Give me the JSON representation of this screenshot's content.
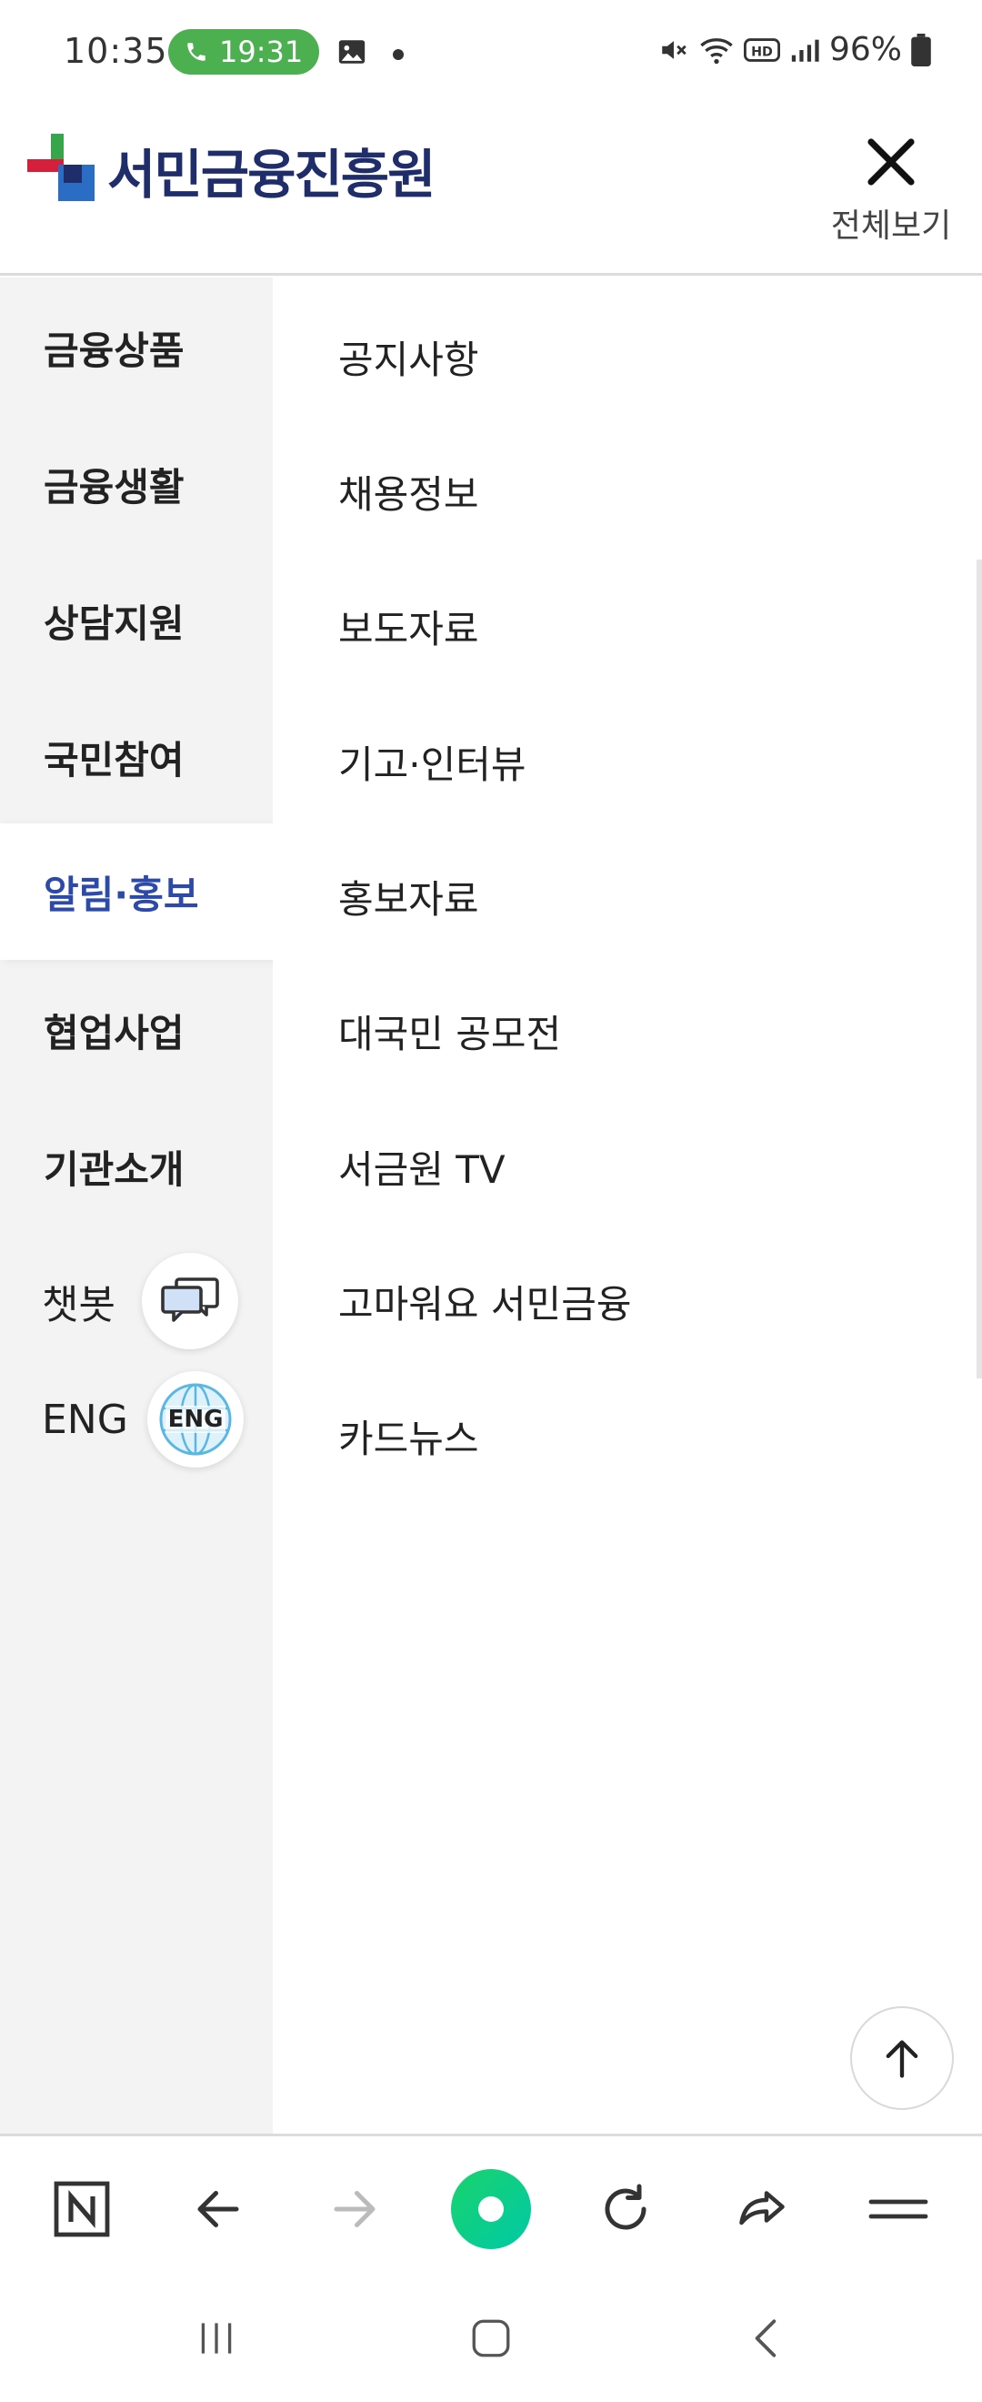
{
  "status_bar": {
    "time": "10:35",
    "call_timer": "19:31",
    "battery": "96%"
  },
  "header": {
    "logo_text": "서민금융진흥원",
    "close_label": "전체보기"
  },
  "left_menu": {
    "items": [
      {
        "label": "금융상품"
      },
      {
        "label": "금융생활"
      },
      {
        "label": "상담지원"
      },
      {
        "label": "국민참여"
      },
      {
        "label": "알림·홍보"
      },
      {
        "label": "협업사업"
      },
      {
        "label": "기관소개"
      }
    ],
    "chatbot_label": "챗봇",
    "eng_label": "ENG",
    "eng_icon_text": "ENG"
  },
  "sub_menu": {
    "items": [
      {
        "label": "공지사항"
      },
      {
        "label": "채용정보"
      },
      {
        "label": "보도자료"
      },
      {
        "label": "기고·인터뷰"
      },
      {
        "label": "홍보자료"
      },
      {
        "label": "대국민 공모전"
      },
      {
        "label": "서금원 TV"
      },
      {
        "label": "고마워요 서민금융"
      },
      {
        "label": "카드뉴스"
      }
    ]
  },
  "colors": {
    "accent": "#2d4aa8",
    "call_green": "#4caf50",
    "logo_navy": "#1f2d6b"
  },
  "icons": {
    "toolbar": [
      "naver-n-icon",
      "back-arrow-icon",
      "forward-arrow-icon",
      "green-dot-icon",
      "refresh-icon",
      "share-icon",
      "menu-icon"
    ],
    "nav": [
      "recent-apps-icon",
      "home-icon",
      "back-icon"
    ]
  }
}
